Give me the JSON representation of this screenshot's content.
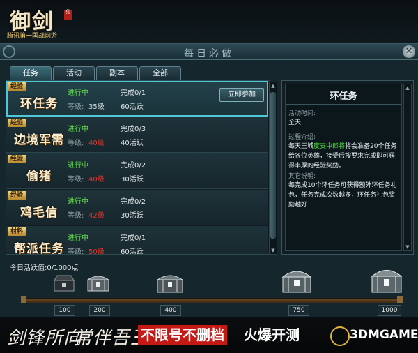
{
  "logo": {
    "title": "御剑",
    "badge": "仙",
    "subtitle": "腾讯第一国战网游"
  },
  "window": {
    "title": "每日必做",
    "close": "✕"
  },
  "tabs": [
    "任务",
    "活动",
    "副本",
    "全部"
  ],
  "tasks": [
    {
      "tag": "经验",
      "name": "环任务",
      "status": "进行中",
      "level_label": "等级:",
      "level": "35级",
      "level_red": false,
      "done": "完成0/1",
      "points": "60活跃",
      "button": "立即参加",
      "selected": true
    },
    {
      "tag": "经验",
      "name": "边境军需",
      "status": "进行中",
      "level_label": "等级:",
      "level": "40级",
      "level_red": true,
      "done": "完成0/3",
      "points": "40活跃"
    },
    {
      "tag": "经验",
      "name": "偷猪",
      "status": "进行中",
      "level_label": "等级:",
      "level": "40级",
      "level_red": true,
      "done": "完成0/2",
      "points": "30活跃"
    },
    {
      "tag": "经验",
      "name": "鸡毛信",
      "status": "进行中",
      "level_label": "等级:",
      "level": "42级",
      "level_red": true,
      "done": "完成0/2",
      "points": "30活跃"
    },
    {
      "tag": "材料",
      "name": "帮派任务",
      "status": "进行中",
      "level_label": "等级:",
      "level": "50级",
      "level_red": true,
      "done": "完成0/1",
      "points": "60活跃"
    }
  ],
  "detail": {
    "title": "环任务",
    "time_label": "活动时间:",
    "time": "全天",
    "intro_label": "过程介绍:",
    "intro_pre": "每天王城",
    "intro_link": "度支中郎将",
    "intro_post": "将会准备20个任务给各位英雄，接受后按要求完成即可获得丰厚的经验奖励。",
    "other_label": "其它说明:",
    "other": "每完成10个环任务可获得额外环任务礼包，任务完成次数越多，环任务礼包奖励越好"
  },
  "activity": {
    "label": "今日活跃值:0/1000点",
    "milestones": [
      "100",
      "200",
      "400",
      "750",
      "1000"
    ]
  },
  "banner": {
    "callig1": "剑锋所向",
    "callig2": "常伴吾王",
    "red_text": "不限号不删档",
    "white_text": "火爆开测",
    "watermark": "3DMGAME"
  }
}
